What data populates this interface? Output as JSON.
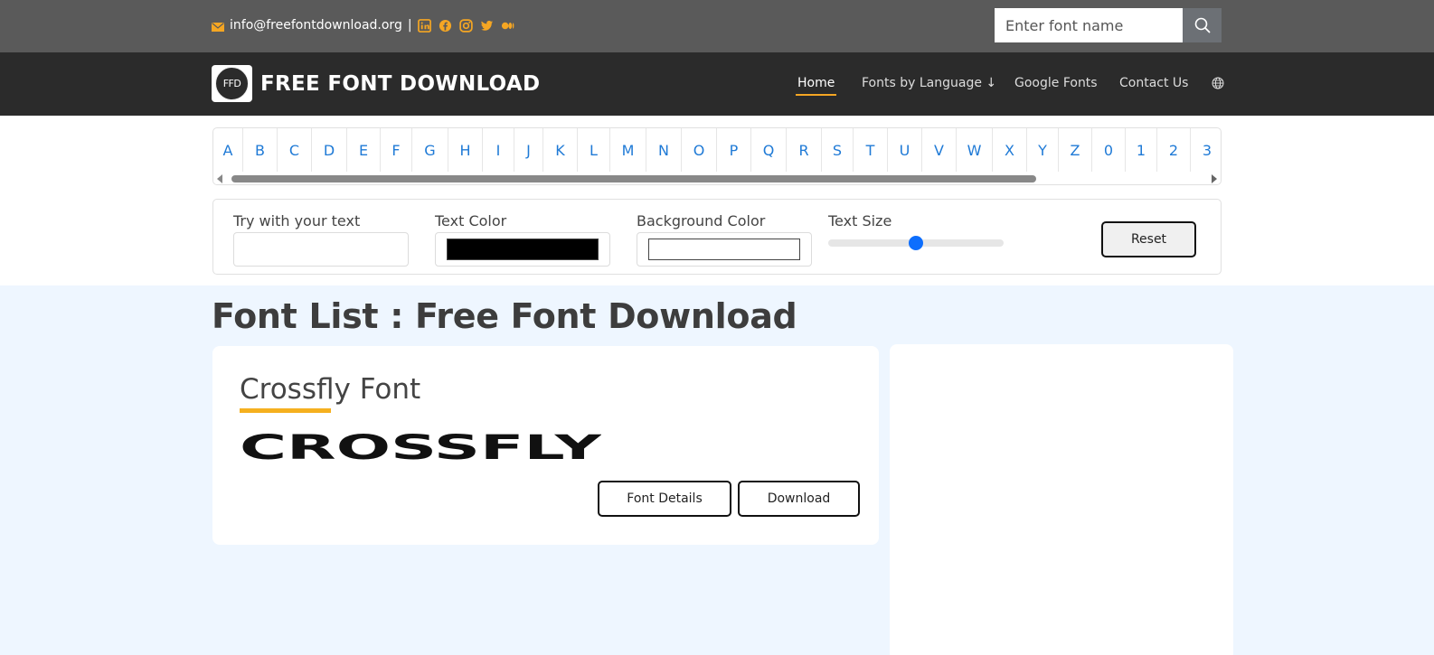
{
  "topbar": {
    "email": "info@freefontdownload.org",
    "separator": "|",
    "social_icons": [
      "linkedin-icon",
      "facebook-icon",
      "instagram-icon",
      "twitter-icon",
      "medium-icon"
    ],
    "accent_color": "#f5a623"
  },
  "search": {
    "placeholder": "Enter font name",
    "icon": "search-icon"
  },
  "navbar": {
    "logo_text": "FFD",
    "brand": "FREE FONT DOWNLOAD",
    "items": [
      {
        "label": "Home",
        "active": true
      },
      {
        "label": "Fonts by Language ↓",
        "active": false
      },
      {
        "label": "Google Fonts",
        "active": false
      },
      {
        "label": "Contact Us",
        "active": false
      }
    ],
    "globe_icon": "globe-icon"
  },
  "alphabet": [
    "A",
    "B",
    "C",
    "D",
    "E",
    "F",
    "G",
    "H",
    "I",
    "J",
    "K",
    "L",
    "M",
    "N",
    "O",
    "P",
    "Q",
    "R",
    "S",
    "T",
    "U",
    "V",
    "W",
    "X",
    "Y",
    "Z",
    "0",
    "1",
    "2",
    "3"
  ],
  "tools": {
    "text_label": "Try with your text",
    "text_value": "",
    "color_label": "Text Color",
    "color_value": "#000000",
    "bg_label": "Background Color",
    "bg_value": "#ffffff",
    "size_label": "Text Size",
    "size_fraction": 0.5,
    "reset_label": "Reset"
  },
  "page_title": "Font List : Free Font Download",
  "fonts": [
    {
      "name": "Crossfly Font",
      "preview_text": "CROSSFLY",
      "details_label": "Font Details",
      "download_label": "Download"
    }
  ]
}
